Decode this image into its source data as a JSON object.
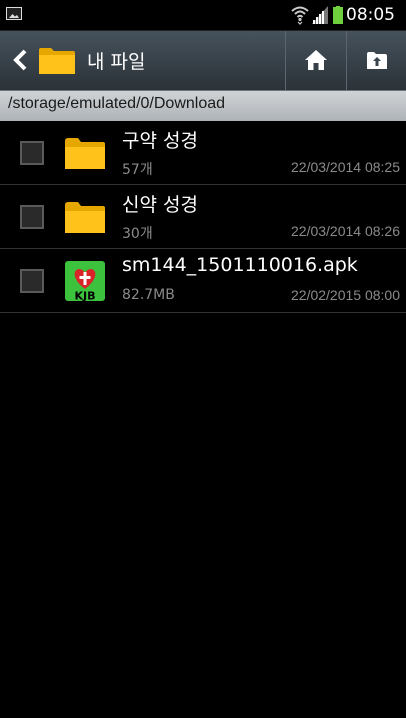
{
  "status_bar": {
    "time": "08:05",
    "icons": [
      "gallery-icon",
      "wifi-icon",
      "signal-icon",
      "battery-icon"
    ]
  },
  "action_bar": {
    "title": "내 파일",
    "icons": [
      "back-icon",
      "folder-icon",
      "home-icon",
      "up-folder-icon"
    ]
  },
  "path": "/storage/emulated/0/Download",
  "files": [
    {
      "name": "구약 성경",
      "meta": "57개",
      "date": "22/03/2014 08:25",
      "icon": "folder-icon"
    },
    {
      "name": "신약 성경",
      "meta": "30개",
      "date": "22/03/2014 08:26",
      "icon": "folder-icon"
    },
    {
      "name": "sm144_1501110016.apk",
      "meta": "82.7MB",
      "date": "22/02/2015 08:00",
      "icon": "kjb-app-icon",
      "icon_text": "KJB"
    }
  ],
  "colors": {
    "folder": "#f5b700",
    "app_icon_green": "#3cc23c",
    "app_icon_heart": "#d9252a",
    "battery": "#6fcf3c",
    "action_bar": "#3a444d",
    "path_bar": "#bcc0c4"
  }
}
